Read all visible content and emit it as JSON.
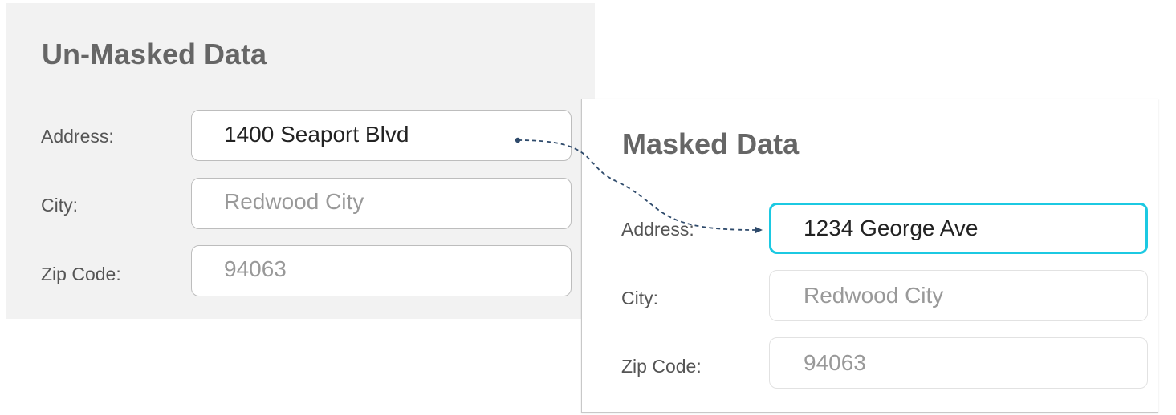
{
  "unmasked": {
    "title": "Un-Masked Data",
    "address_label": "Address:",
    "address_value": "1400 Seaport Blvd",
    "city_label": "City:",
    "city_value": "Redwood City",
    "zip_label": "Zip Code:",
    "zip_value": "94063"
  },
  "masked": {
    "title": "Masked Data",
    "address_label": "Address:",
    "address_value": "1234 George Ave",
    "city_label": "City:",
    "city_value": "Redwood City",
    "zip_label": "Zip Code:",
    "zip_value": "94063"
  },
  "colors": {
    "panel_gray": "#f2f2f2",
    "title_text": "#666666",
    "highlight_border": "#1cc9e2",
    "connector": "#2e4a6b"
  }
}
